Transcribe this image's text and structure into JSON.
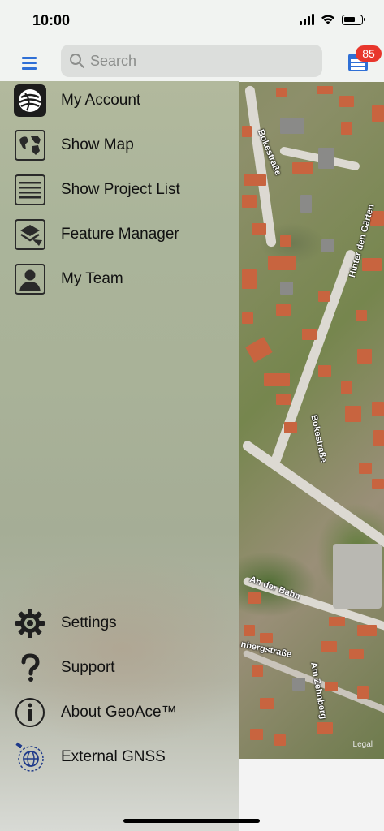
{
  "status": {
    "time": "10:00"
  },
  "search": {
    "placeholder": "Search"
  },
  "projects": {
    "badge_count": "85"
  },
  "menu_top": [
    {
      "label": "My Account",
      "icon": "account-logo-icon"
    },
    {
      "label": "Show Map",
      "icon": "globe-map-icon"
    },
    {
      "label": "Show Project List",
      "icon": "list-icon"
    },
    {
      "label": "Feature Manager",
      "icon": "layers-icon"
    },
    {
      "label": "My Team",
      "icon": "person-icon"
    }
  ],
  "menu_bottom": [
    {
      "label": "Settings",
      "icon": "gear-icon"
    },
    {
      "label": "Support",
      "icon": "question-icon"
    },
    {
      "label": "About GeoAce™",
      "icon": "info-icon"
    },
    {
      "label": "External GNSS",
      "icon": "gnss-satellite-icon"
    }
  ],
  "map": {
    "streets": [
      "Bokestraße",
      "Hinter den Gärten",
      "Bokestraße",
      "An der Bahn",
      "nbergstraße",
      "Am Zehnberg"
    ],
    "legal": "Legal"
  },
  "colors": {
    "accent": "#2f6fd6",
    "badge": "#e8362c"
  }
}
